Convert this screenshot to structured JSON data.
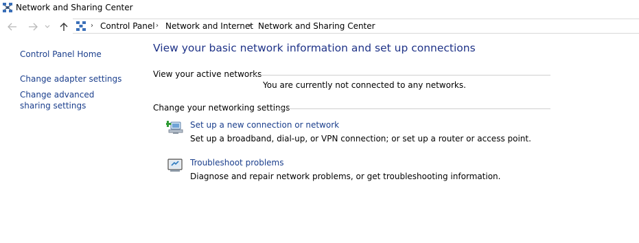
{
  "window": {
    "title": "Network and Sharing Center",
    "title_icon": "network-sharing-icon"
  },
  "nav": {
    "back_icon": "back-arrow-icon",
    "forward_icon": "forward-arrow-icon",
    "recent_icon": "chevron-down-icon",
    "up_icon": "up-arrow-icon"
  },
  "breadcrumb": {
    "icon": "control-panel-icon",
    "items": [
      "Control Panel",
      "Network and Internet",
      "Network and Sharing Center"
    ]
  },
  "sidebar": {
    "items": [
      {
        "label": "Control Panel Home"
      },
      {
        "label": "Change adapter settings"
      },
      {
        "label": "Change advanced sharing settings"
      }
    ]
  },
  "main": {
    "title": "View your basic network information and set up connections",
    "active_networks": {
      "label": "View your active networks",
      "status": "You are currently not connected to any networks."
    },
    "networking_settings": {
      "label": "Change your networking settings",
      "tasks": [
        {
          "icon": "new-connection-icon",
          "link": "Set up a new connection or network",
          "description": "Set up a broadband, dial-up, or VPN connection; or set up a router or access point."
        },
        {
          "icon": "troubleshoot-icon",
          "link": "Troubleshoot problems",
          "description": "Diagnose and repair network problems, or get troubleshooting information."
        }
      ]
    }
  },
  "colors": {
    "link": "#1a3e8c",
    "title": "#1e3287",
    "divider": "#cfcfcf"
  }
}
